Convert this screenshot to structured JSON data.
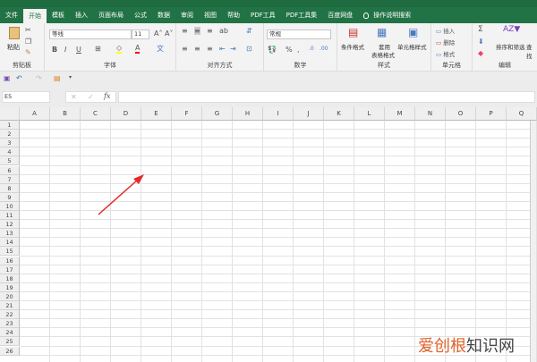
{
  "tabs": [
    "文件",
    "开始",
    "模板",
    "插入",
    "页面布局",
    "公式",
    "数据",
    "审阅",
    "视图",
    "帮助",
    "PDF工具",
    "PDF工具集",
    "百度网盘"
  ],
  "active_tab": "开始",
  "search_hint": "操作说明搜索",
  "ribbon": {
    "clipboard": {
      "paste": "粘贴",
      "label": "剪贴板"
    },
    "font": {
      "name": "等线",
      "size": "11",
      "bold": "B",
      "italic": "I",
      "underline": "U",
      "label": "字体",
      "grow": "A˄",
      "shrink": "A˅",
      "font_color": "A",
      "highlight_color": "#ffff00",
      "font_color_value": "#ff0000"
    },
    "alignment": {
      "label": "对齐方式"
    },
    "number": {
      "format": "常规",
      "percent": "%",
      "comma": ",",
      "label": "数字"
    },
    "styles": {
      "conditional": "条件格式",
      "table1": "套用",
      "table2": "表格格式",
      "cell_styles": "单元格样式",
      "label": "样式"
    },
    "cells": {
      "insert": "插入",
      "delete": "删除",
      "format": "格式",
      "label": "单元格"
    },
    "editing": {
      "sum": "Σ",
      "sort": "排序和筛选",
      "find": "查找",
      "label": "编辑"
    }
  },
  "name_box": "E5",
  "formula_fx": "fx",
  "formula_value": "",
  "columns": [
    "A",
    "B",
    "C",
    "D",
    "E",
    "F",
    "G",
    "H",
    "I",
    "J",
    "K",
    "L",
    "M",
    "N",
    "O",
    "P",
    "Q"
  ],
  "rows": [
    "1",
    "2",
    "3",
    "4",
    "5",
    "6",
    "7",
    "8",
    "9",
    "10",
    "11",
    "12",
    "13",
    "14",
    "15",
    "16",
    "17",
    "18",
    "19",
    "20",
    "21",
    "22",
    "23",
    "24",
    "25",
    "26"
  ],
  "watermark": {
    "part1": "爱创根",
    "part2": "知识网"
  },
  "colors": {
    "brand": "#217346",
    "arrow": "#e52a2a"
  }
}
